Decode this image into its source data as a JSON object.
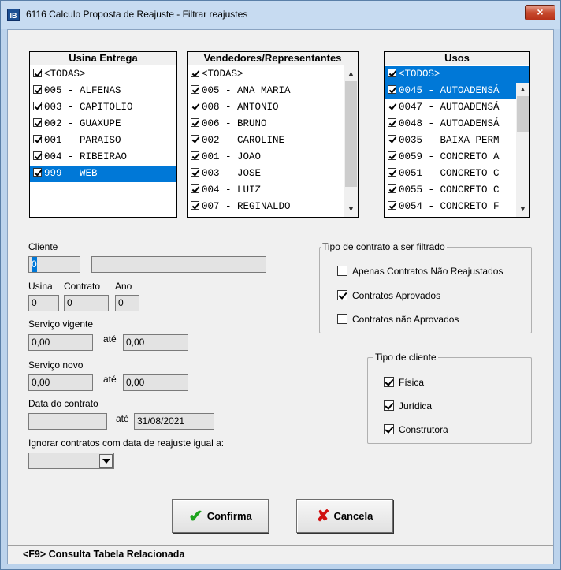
{
  "window": {
    "title": "6116 Calculo Proposta de Reajuste - Filtrar reajustes",
    "close_glyph": "×"
  },
  "usina_entrega": {
    "header": "Usina Entrega",
    "items": [
      {
        "label": "<TODAS>",
        "checked": true
      },
      {
        "label": "005 - ALFENAS",
        "checked": true
      },
      {
        "label": "003 - CAPITOLIO",
        "checked": true
      },
      {
        "label": "002 - GUAXUPE",
        "checked": true
      },
      {
        "label": "001 - PARAISO",
        "checked": true
      },
      {
        "label": "004 - RIBEIRAO",
        "checked": true
      },
      {
        "label": "999 - WEB",
        "checked": true,
        "selected": true
      }
    ]
  },
  "vendedores": {
    "header": "Vendedores/Representantes",
    "items": [
      {
        "label": "<TODAS>",
        "checked": true
      },
      {
        "label": "005 - ANA MARIA",
        "checked": true
      },
      {
        "label": "008 - ANTONIO",
        "checked": true
      },
      {
        "label": "006 - BRUNO",
        "checked": true
      },
      {
        "label": "002 - CAROLINE",
        "checked": true
      },
      {
        "label": "001 - JOAO",
        "checked": true
      },
      {
        "label": "003 - JOSE",
        "checked": true
      },
      {
        "label": "004 - LUIZ",
        "checked": true
      },
      {
        "label": "007 - REGINALDO",
        "checked": true
      }
    ]
  },
  "usos": {
    "header": "Usos",
    "items": [
      {
        "label": "<TODOS>",
        "checked": true,
        "selected": true
      },
      {
        "label": "0045 - AUTOADENSÁ",
        "checked": true,
        "selected": true
      },
      {
        "label": "0047 - AUTOADENSÁ",
        "checked": true
      },
      {
        "label": "0048 - AUTOADENSÁ",
        "checked": true
      },
      {
        "label": "0035 - BAIXA PERM",
        "checked": true
      },
      {
        "label": "0059 - CONCRETO A",
        "checked": true
      },
      {
        "label": "0051 - CONCRETO C",
        "checked": true
      },
      {
        "label": "0055 - CONCRETO C",
        "checked": true
      },
      {
        "label": "0054 - CONCRETO F",
        "checked": true
      }
    ]
  },
  "form": {
    "cliente_label": "Cliente",
    "cliente_code": "0",
    "cliente_name": "",
    "usina_label": "Usina",
    "contrato_label": "Contrato",
    "ano_label": "Ano",
    "usina_value": "0",
    "contrato_value": "0",
    "ano_value": "0",
    "servico_vigente_label": "Serviço vigente",
    "servico_vigente_from": "0,00",
    "servico_vigente_to": "0,00",
    "servico_novo_label": "Serviço novo",
    "servico_novo_from": "0,00",
    "servico_novo_to": "0,00",
    "ate_label": "até",
    "data_contrato_label": "Data do contrato",
    "data_contrato_from": "",
    "data_contrato_to": "31/08/2021",
    "ignorar_label": "Ignorar contratos com data de reajuste igual a:",
    "ignorar_value": ""
  },
  "tipo_contrato": {
    "title": "Tipo de contrato a ser filtrado",
    "options": [
      {
        "label": "Apenas Contratos Não Reajustados",
        "checked": false
      },
      {
        "label": "Contratos Aprovados",
        "checked": true
      },
      {
        "label": "Contratos não Aprovados",
        "checked": false
      }
    ]
  },
  "tipo_cliente": {
    "title": "Tipo de cliente",
    "options": [
      {
        "label": "Física",
        "checked": true
      },
      {
        "label": "Jurídica",
        "checked": true
      },
      {
        "label": "Construtora",
        "checked": true
      }
    ]
  },
  "buttons": {
    "confirma": "Confirma",
    "cancela": "Cancela",
    "check_glyph": "✔",
    "x_glyph": "✘"
  },
  "statusbar": {
    "text": "<F9> Consulta Tabela Relacionada"
  },
  "colors": {
    "selection": "#0078d7",
    "confirm_icon": "#1da31d",
    "cancel_icon": "#d01010",
    "close_button": "#c74a2e"
  }
}
